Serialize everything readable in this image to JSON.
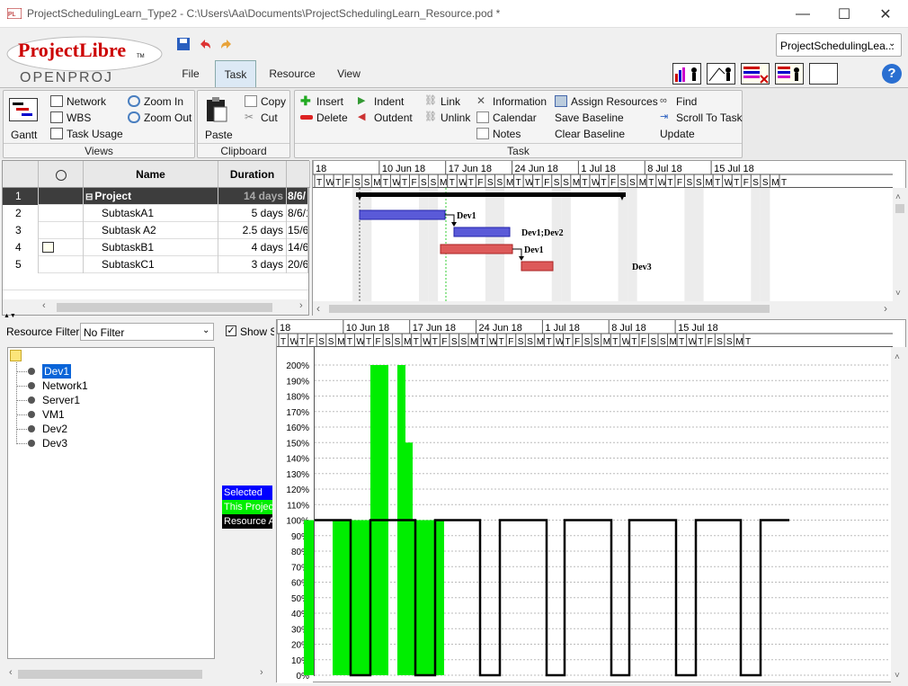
{
  "window": {
    "title": "ProjectSchedulingLearn_Type2 - C:\\Users\\Aa\\Documents\\ProjectSchedulingLearn_Resource.pod *",
    "minimize": "—",
    "maximize": "☐",
    "close": "✕"
  },
  "header": {
    "logo_main": "ProjectLibre",
    "logo_tm": "TM",
    "logo_sub": "OPENPROJ",
    "project_dropdown": "ProjectSchedulingLea...",
    "help": "?"
  },
  "tabs": [
    {
      "label": "File"
    },
    {
      "label": "Task",
      "active": true
    },
    {
      "label": "Resource"
    },
    {
      "label": "View"
    }
  ],
  "ribbon": {
    "views": {
      "label": "Views",
      "gantt": "Gantt",
      "network": "Network",
      "wbs": "WBS",
      "task_usage": "Task Usage",
      "zoom_in": "Zoom In",
      "zoom_out": "Zoom Out"
    },
    "clipboard": {
      "label": "Clipboard",
      "paste": "Paste",
      "copy": "Copy",
      "cut": "Cut"
    },
    "task": {
      "label": "Task",
      "insert": "Insert",
      "delete": "Delete",
      "indent": "Indent",
      "outdent": "Outdent",
      "link": "Link",
      "unlink": "Unlink",
      "information": "Information",
      "calendar": "Calendar",
      "notes": "Notes",
      "assign_resources": "Assign Resources",
      "save_baseline": "Save Baseline",
      "clear_baseline": "Clear Baseline",
      "find": "Find",
      "scroll_to_task": "Scroll To Task",
      "update": "Update"
    }
  },
  "table": {
    "headers": {
      "name": "Name",
      "duration": "Duration"
    },
    "rows": [
      {
        "id": "1",
        "name": "Project",
        "duration": "14 days",
        "start": "8/6/",
        "summary": true
      },
      {
        "id": "2",
        "name": "SubtaskA1",
        "duration": "5 days",
        "start": "8/6/1"
      },
      {
        "id": "3",
        "name": "Subtask A2",
        "duration": "2.5 days",
        "start": "15/6/"
      },
      {
        "id": "4",
        "name": "SubtaskB1",
        "duration": "4 days",
        "start": "14/6/"
      },
      {
        "id": "5",
        "name": "SubtaskC1",
        "duration": "3 days",
        "start": "20/6/"
      }
    ]
  },
  "timescale": {
    "weeks": [
      "18",
      "10 Jun 18",
      "17 Jun 18",
      "24 Jun 18",
      "1 Jul 18",
      "8 Jul 18",
      "15 Jul 18"
    ],
    "days": "T W T F S S M T W T F S S M T W T F S S M T W T F S S M T W T F S S M T W T F S S M T W T F S S M T"
  },
  "gantt": {
    "labels": [
      "Dev1",
      "Dev1;Dev2",
      "Dev1",
      "Dev3"
    ]
  },
  "resources": {
    "filter_label": "Resource Filter:",
    "filter_value": "No Filter",
    "show_label": "Show S",
    "items": [
      "Dev1",
      "Network1",
      "Server1",
      "VM1",
      "Dev2",
      "Dev3"
    ],
    "selected": "Dev1"
  },
  "legend": [
    {
      "label": "Selected",
      "color": "#0000ff"
    },
    {
      "label": "This Project",
      "color": "#00ee00"
    },
    {
      "label": "Resource A",
      "color": "#000000"
    }
  ],
  "histogram": {
    "y_ticks": [
      "200%",
      "190%",
      "180%",
      "170%",
      "160%",
      "150%",
      "140%",
      "130%",
      "120%",
      "110%",
      "100%",
      "90%",
      "80%",
      "70%",
      "60%",
      "50%",
      "40%",
      "30%",
      "20%",
      "10%",
      "0%"
    ],
    "green_color": "#00ee00",
    "green_segments": [
      {
        "day": 1,
        "value": 100
      },
      {
        "day": 4,
        "value": 100
      },
      {
        "day": 5,
        "value": 100
      },
      {
        "day": 6,
        "value": 200
      },
      {
        "day": 7,
        "value": 200
      },
      {
        "day": 8,
        "value": 100
      },
      {
        "day": 9,
        "value": 200
      },
      {
        "day": 10,
        "value": 150
      },
      {
        "day": 11,
        "value": 100
      },
      {
        "day": 12,
        "value": 100
      }
    ]
  }
}
